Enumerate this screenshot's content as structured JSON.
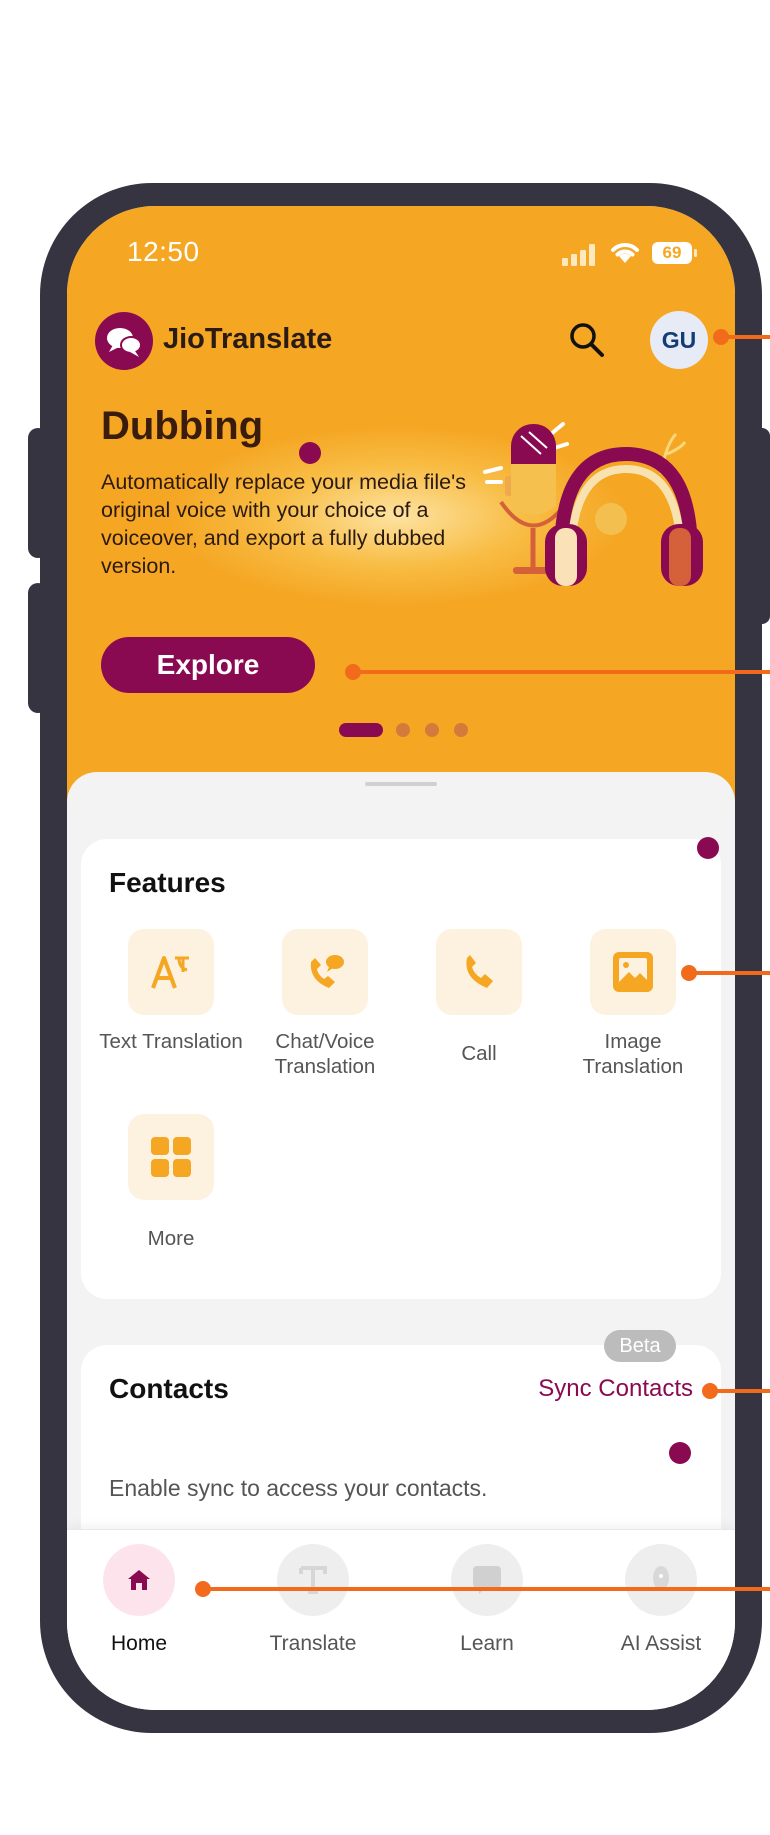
{
  "status_bar": {
    "time": "12:50",
    "battery": "69"
  },
  "header": {
    "app_name": "JioTranslate",
    "avatar_initials": "GU"
  },
  "hero": {
    "title": "Dubbing",
    "description": "Automatically replace your media file's original voice with your choice of a voiceover, and export a fully dubbed version.",
    "cta_label": "Explore",
    "slide_count": 4,
    "active_slide": 1
  },
  "features": {
    "title": "Features",
    "items": [
      {
        "label": "Text Translation",
        "icon": "text-translation-icon"
      },
      {
        "label": "Chat/Voice Translation",
        "icon": "chat-voice-icon"
      },
      {
        "label": "Call",
        "icon": "phone-icon"
      },
      {
        "label": "Image Translation",
        "icon": "image-icon"
      },
      {
        "label": "More",
        "icon": "grid-icon"
      }
    ]
  },
  "contacts": {
    "title": "Contacts",
    "sync_label": "Sync Contacts",
    "message": "Enable sync to access your contacts."
  },
  "bottom_nav": {
    "items": [
      {
        "label": "Home",
        "icon": "home-icon",
        "active": true
      },
      {
        "label": "Translate",
        "icon": "translate-icon",
        "active": false
      },
      {
        "label": "Learn",
        "icon": "learn-icon",
        "active": false
      },
      {
        "label": "AI Assist",
        "icon": "ai-assist-icon",
        "active": false
      }
    ],
    "beta_badge": "Beta"
  },
  "colors": {
    "brand_orange": "#f5a623",
    "brand_magenta": "#8a0a52",
    "annotation": "#f26b1d"
  }
}
